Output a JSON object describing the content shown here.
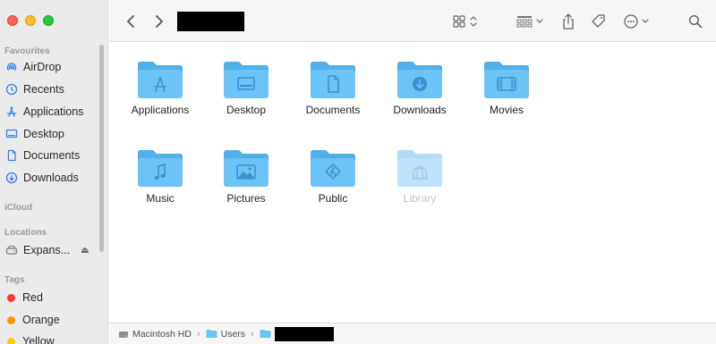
{
  "sidebar": {
    "sections": {
      "favourites": "Favourites",
      "icloud": "iCloud",
      "locations": "Locations",
      "tags": "Tags"
    },
    "favourites": [
      {
        "label": "AirDrop",
        "icon": "airdrop-icon"
      },
      {
        "label": "Recents",
        "icon": "clock-icon"
      },
      {
        "label": "Applications",
        "icon": "applications-icon"
      },
      {
        "label": "Desktop",
        "icon": "desktop-icon"
      },
      {
        "label": "Documents",
        "icon": "document-icon"
      },
      {
        "label": "Downloads",
        "icon": "download-icon"
      }
    ],
    "locations": [
      {
        "label": "Expans...",
        "icon": "drive-icon",
        "eject": "⏏"
      }
    ],
    "tags": [
      {
        "label": "Red",
        "color": "#ff3b30"
      },
      {
        "label": "Orange",
        "color": "#ff9500"
      },
      {
        "label": "Yellow",
        "color": "#ffcc00"
      }
    ]
  },
  "toolbar": {
    "back": "back-chevron-icon",
    "forward": "forward-chevron-icon",
    "view_toggle": "icon-grid-view-icon",
    "group": "group-by-icon",
    "share": "share-icon",
    "tag": "tag-icon",
    "more": "ellipsis-circle-icon",
    "search": "search-icon"
  },
  "folders": [
    {
      "label": "Applications",
      "glyph": "applications",
      "dim": false
    },
    {
      "label": "Desktop",
      "glyph": "desktop",
      "dim": false
    },
    {
      "label": "Documents",
      "glyph": "document",
      "dim": false
    },
    {
      "label": "Downloads",
      "glyph": "download",
      "dim": false
    },
    {
      "label": "Movies",
      "glyph": "film",
      "dim": false
    },
    {
      "label": "Music",
      "glyph": "music",
      "dim": false
    },
    {
      "label": "Pictures",
      "glyph": "photo",
      "dim": false
    },
    {
      "label": "Public",
      "glyph": "public",
      "dim": false
    },
    {
      "label": "Library",
      "glyph": "library",
      "dim": true
    }
  ],
  "pathbar": {
    "disk": "Macintosh HD",
    "users": "Users"
  },
  "colors": {
    "folder_front": "#6cc3f5",
    "folder_back": "#4fb0ea",
    "folder_glyph": "#3c8fd0"
  }
}
